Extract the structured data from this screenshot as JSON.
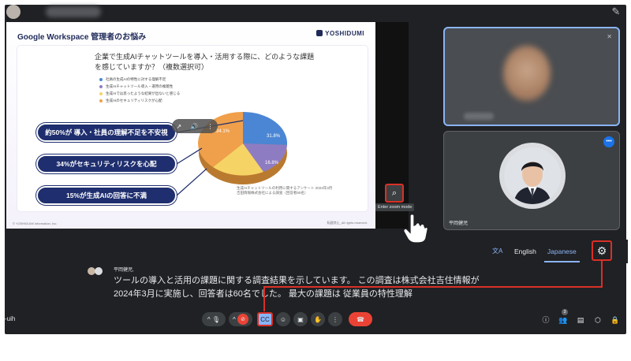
{
  "slide": {
    "title": "Google Workspace 管理者のお悩み",
    "logo": "YOSHIDUMI",
    "question_line1": "企業で生成AIチャットツールを導入・活用する際に、どのような課題",
    "question_line2": "を感じていますか？（複数選択可）",
    "legend": [
      {
        "label": "社員の生成AIの特性に対する理解不足",
        "color": "#4a86d4"
      },
      {
        "label": "生成AIチャットツール導入・運用の複雑性",
        "color": "#8e7cc3"
      },
      {
        "label": "生成AIでは思ったような結果が出ないと感じる",
        "color": "#f6d365"
      },
      {
        "label": "生成AIのセキュリティリスクが心配",
        "color": "#f0a04b"
      }
    ],
    "pie_labels": [
      "31.8%",
      "16.8%",
      "34.1%"
    ],
    "callouts": [
      "約50%が 導入・社員の理解不足を不安視",
      "34%がセキュリティリスクを心配",
      "15%が生成AIの回答に不満"
    ],
    "source_line1": "生成AIチャットツールの利用に関するアンケート 2024年3月",
    "source_line2": "吉田情報株式会社による調査（回答者60名）",
    "footer_left": "© YOSHIDUMI Information, Inc.",
    "footer_right": "転載禁止_All rights reserved."
  },
  "zoom": {
    "tooltip": "Enter zoom mode"
  },
  "tiles": [
    {
      "name_visible": false
    },
    {
      "name": "平岡健児"
    }
  ],
  "captions": {
    "languages": [
      "English",
      "Japanese"
    ],
    "active_language": "Japanese",
    "speaker": "平岡健児,",
    "line1": "ツールの導入と活用の課題に関する調査結果を示しています。 この調査は株式会社吉住情報が",
    "line2": "2024年3月に実施し、回答者は60名でした。 最大の課題は 従業員の特性理解"
  },
  "toolbar": {
    "meeting_code_suffix": "-uih",
    "participants_count": "3"
  },
  "colors": {
    "background": "#202124",
    "accent": "#8ab4f8",
    "highlight": "#d93025",
    "end_call": "#ea4335"
  },
  "icons": [
    "pen-icon",
    "mic-icon",
    "video-off-icon",
    "captions-icon",
    "emoji-icon",
    "present-icon",
    "raise-hand-icon",
    "more-icon",
    "end-call-icon",
    "info-icon",
    "people-icon",
    "chat-icon",
    "activities-icon",
    "host-controls-icon",
    "settings-gear-icon",
    "translate-icon",
    "zoom-icon"
  ]
}
